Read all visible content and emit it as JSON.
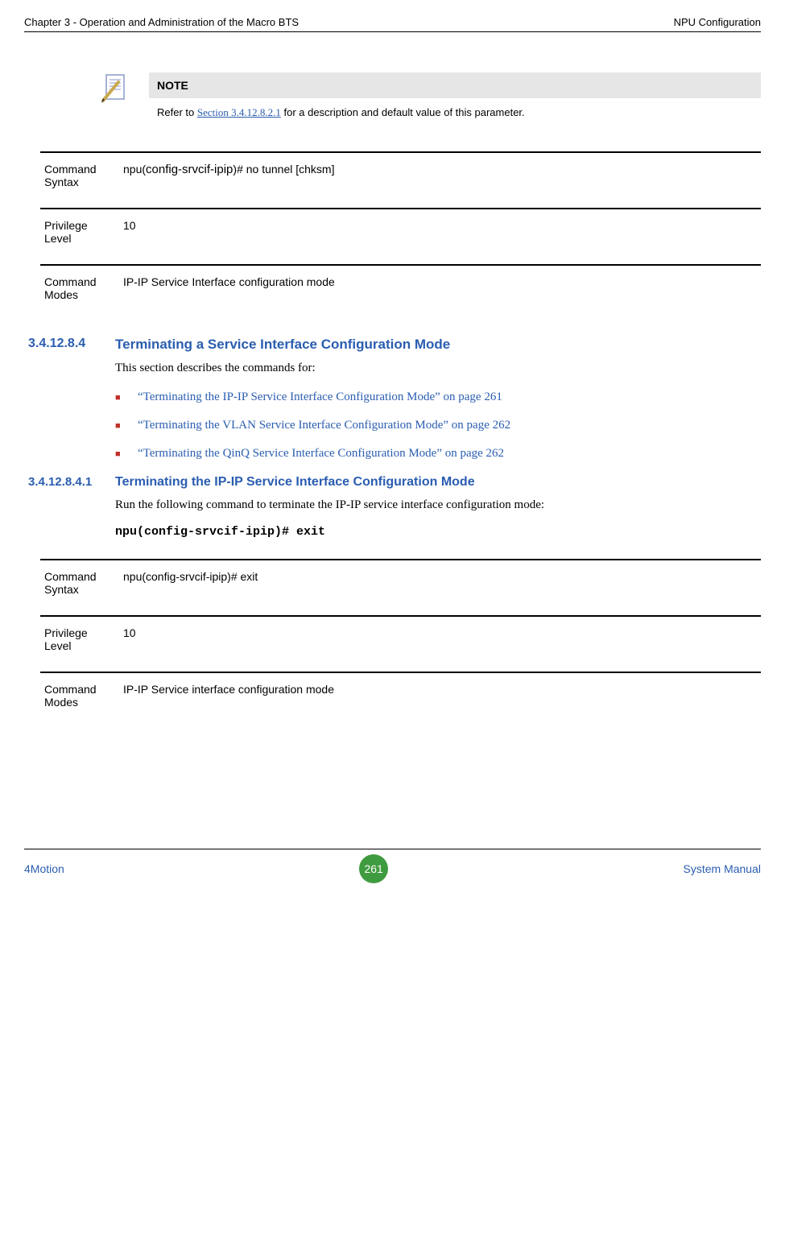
{
  "header": {
    "left": "Chapter 3 - Operation and Administration of the Macro BTS",
    "right": "NPU Configuration"
  },
  "note": {
    "title": "NOTE",
    "prefix": "Refer to ",
    "link": "Section 3.4.12.8.2.1",
    "suffix": " for a description and default value of this parameter."
  },
  "block1": {
    "cmdSyntaxLabel": "Command Syntax",
    "cmdSyntaxValuePrefix": "npu(",
    "cmdSyntaxValueMid": "config-srvcif-ipip",
    "cmdSyntaxValueSuffix": ")# no tunnel [chksm]",
    "privLabel": "Privilege Level",
    "privValue": "10",
    "modesLabel": "Command Modes",
    "modesValue": "IP-IP Service Interface configuration mode"
  },
  "section1": {
    "num": "3.4.12.8.4",
    "title": "Terminating a Service Interface Configuration Mode",
    "intro": "This section describes the commands for:",
    "bullets": [
      "“Terminating the IP-IP Service Interface Configuration Mode” on page 261",
      "“Terminating the VLAN Service Interface Configuration Mode” on page 262",
      "“Terminating the QinQ Service Interface Configuration Mode” on page 262"
    ]
  },
  "section2": {
    "num": "3.4.12.8.4.1",
    "title": "Terminating the IP-IP Service Interface Configuration Mode",
    "body": "Run the following command to terminate the IP-IP service interface configuration mode:",
    "code": "npu(config-srvcif-ipip)# exit"
  },
  "block2": {
    "cmdSyntaxLabel": "Command Syntax",
    "cmdSyntaxValue": "npu(config-srvcif-ipip)# exit",
    "privLabel": "Privilege Level",
    "privValue": "10",
    "modesLabel": "Command Modes",
    "modesValue": "IP-IP Service interface configuration mode"
  },
  "footer": {
    "left": "4Motion",
    "page": "261",
    "right": "System Manual"
  }
}
